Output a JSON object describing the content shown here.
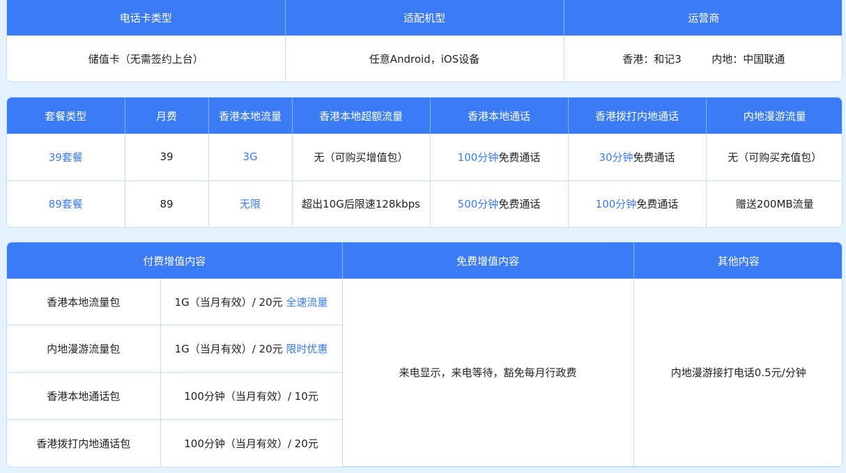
{
  "card_info": {
    "headers": [
      "电话卡类型",
      "适配机型",
      "运营商"
    ],
    "card_type": "储值卡（无需签约上台）",
    "devices": "任意Android，iOS设备",
    "carrier_hk": "香港：和记3",
    "carrier_mainland": "内地：中国联通"
  },
  "plans": {
    "headers": [
      "套餐类型",
      "月费",
      "香港本地流量",
      "香港本地超额流量",
      "香港本地通话",
      "香港拨打内地通话",
      "内地漫游流量"
    ],
    "rows": [
      {
        "name": "39套餐",
        "fee": "39",
        "hk_data": "3G",
        "hk_excess": "无（可购买增值包）",
        "hk_call_highlight": "100分钟",
        "hk_call_rest": "免费通话",
        "mainland_call_highlight": "30分钟",
        "mainland_call_rest": "免费通话",
        "roaming": "无（可购买充值包）"
      },
      {
        "name": "89套餐",
        "fee": "89",
        "hk_data": "无限",
        "hk_excess": "超出10G后限速128kbps",
        "hk_call_highlight": "500分钟",
        "hk_call_rest": "免费通话",
        "mainland_call_highlight": "100分钟",
        "mainland_call_rest": "免费通话",
        "roaming": "赠送200MB流量"
      }
    ]
  },
  "addons": {
    "headers": [
      "付费增值内容",
      "免费增值内容",
      "其他内容"
    ],
    "paid": [
      {
        "name": "香港本地流量包",
        "detail": "1G（当月有效）/ 20元",
        "tag": "全速流量"
      },
      {
        "name": "内地漫游流量包",
        "detail": "1G（当月有效）/ 20元",
        "tag": "限时优惠"
      },
      {
        "name": "香港本地通话包",
        "detail": "100分钟（当月有效）/ 10元",
        "tag": ""
      },
      {
        "name": "香港拨打内地通话包",
        "detail": "100分钟（当月有效）/ 20元",
        "tag": ""
      }
    ],
    "free": "来电显示，来电等待，豁免每月行政费",
    "other": "内地漫游接打电话0.5元/分钟"
  },
  "colors": {
    "accent": "#3b7cf6",
    "background": "#e3f2fc",
    "border": "#c6dff4"
  }
}
